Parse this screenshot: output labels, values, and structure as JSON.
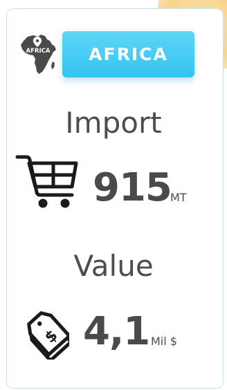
{
  "region": {
    "icon_label": "AFRICA",
    "button_label": "AFRICA",
    "accent_color": "#3cc8f2",
    "icon": "africa-map-pin-icon"
  },
  "import": {
    "heading": "Import",
    "value": "915",
    "unit": "MT",
    "icon": "shopping-cart-icon"
  },
  "value": {
    "heading": "Value",
    "value": "4,1",
    "unit": "Mil $",
    "icon": "price-tag-dollar-icon"
  }
}
